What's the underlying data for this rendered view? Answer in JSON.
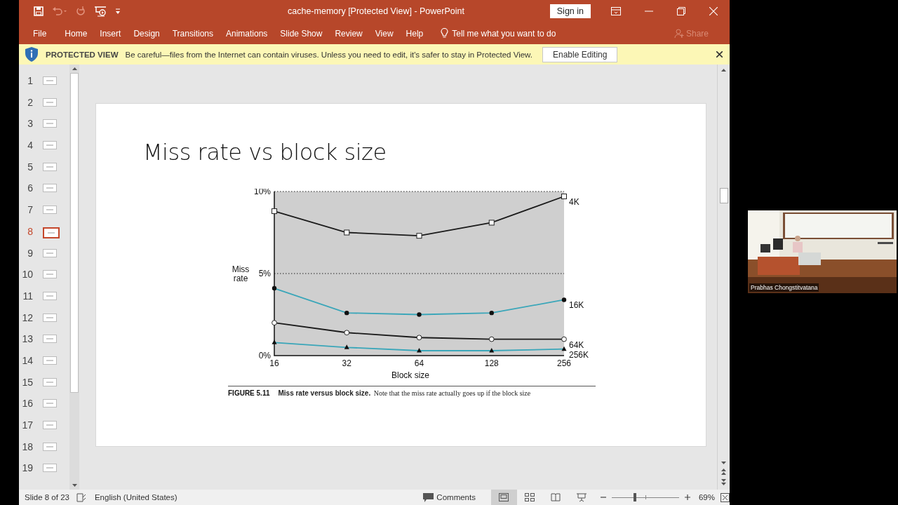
{
  "window": {
    "title": "cache-memory [Protected View]  -  PowerPoint",
    "sign_in": "Sign in"
  },
  "ribbon_tabs": [
    {
      "label": "File"
    },
    {
      "label": "Home"
    },
    {
      "label": "Insert"
    },
    {
      "label": "Design"
    },
    {
      "label": "Transitions"
    },
    {
      "label": "Animations"
    },
    {
      "label": "Slide Show"
    },
    {
      "label": "Review"
    },
    {
      "label": "View"
    },
    {
      "label": "Help"
    }
  ],
  "tell_me": {
    "placeholder": "Tell me what you want to do"
  },
  "share": {
    "label": "Share",
    "disabled": true
  },
  "protected_bar": {
    "title": "PROTECTED VIEW",
    "message": "Be careful—files from the Internet can contain viruses. Unless you need to edit, it's safer to stay in Protected View.",
    "button": "Enable Editing"
  },
  "thumbnails": [
    {
      "number": "1",
      "selected": false
    },
    {
      "number": "2",
      "selected": false
    },
    {
      "number": "3",
      "selected": false
    },
    {
      "number": "4",
      "selected": false
    },
    {
      "number": "5",
      "selected": false
    },
    {
      "number": "6",
      "selected": false
    },
    {
      "number": "7",
      "selected": false
    },
    {
      "number": "8",
      "selected": true
    },
    {
      "number": "9",
      "selected": false
    },
    {
      "number": "10",
      "selected": false
    },
    {
      "number": "11",
      "selected": false
    },
    {
      "number": "12",
      "selected": false
    },
    {
      "number": "13",
      "selected": false
    },
    {
      "number": "14",
      "selected": false
    },
    {
      "number": "15",
      "selected": false
    },
    {
      "number": "16",
      "selected": false
    },
    {
      "number": "17",
      "selected": false
    },
    {
      "number": "18",
      "selected": false
    },
    {
      "number": "19",
      "selected": false
    }
  ],
  "slide": {
    "title": "Miss rate vs block size",
    "chart_data": {
      "type": "line",
      "xlabel": "Block size",
      "ylabel": "Miss rate",
      "categories": [
        "16",
        "32",
        "64",
        "128",
        "256"
      ],
      "ylim": [
        0,
        10
      ],
      "yticks": [
        {
          "value": 0,
          "label": "0%"
        },
        {
          "value": 5,
          "label": "5%"
        },
        {
          "value": 10,
          "label": "10%"
        }
      ],
      "series": [
        {
          "name": "4K",
          "color": "#1a1a1a",
          "marker": "square",
          "values": [
            8.8,
            7.5,
            7.3,
            8.1,
            9.7
          ]
        },
        {
          "name": "16K",
          "color": "#3aa6b9",
          "marker": "dot",
          "values": [
            4.1,
            2.6,
            2.5,
            2.6,
            3.4
          ]
        },
        {
          "name": "64K",
          "color": "#1a1a1a",
          "marker": "circle",
          "values": [
            2.0,
            1.4,
            1.1,
            1.0,
            1.0
          ]
        },
        {
          "name": "256K",
          "color": "#3aa6b9",
          "marker": "triangle",
          "values": [
            0.8,
            0.5,
            0.3,
            0.3,
            0.4
          ]
        }
      ]
    },
    "caption": {
      "label": "FIGURE 5.11",
      "text": "**Miss rate versus block size.** Note that the miss rate actually goes up if the block size"
    }
  },
  "status_bar": {
    "slide": "Slide 8 of 23",
    "language": "English (United States)",
    "comments": "Comments",
    "views": [
      {
        "kind": "normal",
        "selected": true
      },
      {
        "kind": "sorter",
        "selected": false
      },
      {
        "kind": "reading",
        "selected": false
      },
      {
        "kind": "slideshow",
        "selected": false
      }
    ],
    "zoom": {
      "level": 0.34,
      "reading": "69%"
    }
  },
  "video": {
    "kind": "picture",
    "name": "Prabhas Chongstitvatana"
  }
}
